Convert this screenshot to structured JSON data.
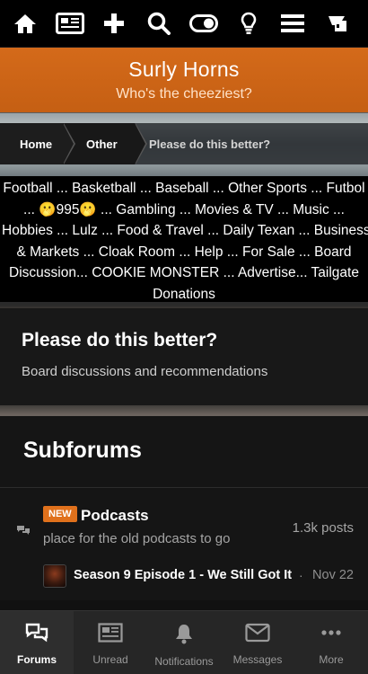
{
  "topbar": {
    "icons": [
      "home-icon",
      "news-icon",
      "plus-icon",
      "search-icon",
      "toggle-icon",
      "lightbulb-icon",
      "menu-icon",
      "flag-icon"
    ]
  },
  "site": {
    "title": "Surly Horns",
    "tagline": "Who's the cheeziest?"
  },
  "breadcrumb": {
    "items": [
      "Home",
      "Other",
      "Please do this better?"
    ]
  },
  "navlinks": {
    "rows": [
      "Football ... Basketball ... Baseball ... Other Sports ... Futbol",
      "... 🫢995🫢 ... Gambling ... Movies & TV ... Music ...",
      "Hobbies ... Lulz ... Food & Travel ... Daily Texan ... Business",
      "& Markets ... Cloak Room ... Help ... For Sale ... Board",
      "Discussion... COOKIE MONSTER ... Advertise... Tailgate",
      "Donations"
    ]
  },
  "forum": {
    "title": "Please do this better?",
    "description": "Board discussions and recommendations"
  },
  "subforums": {
    "heading": "Subforums",
    "items": [
      {
        "badge": "NEW",
        "name": "Podcasts",
        "description": "place for the old podcasts to go",
        "posts": "1.3k posts",
        "last_thread": "Season 9 Episode 1 - We Still Got It",
        "last_sep": "·",
        "last_date": "Nov 22"
      }
    ]
  },
  "bottomnav": {
    "items": [
      {
        "label": "Forums",
        "icon": "chat-bubbles-icon",
        "active": true
      },
      {
        "label": "Unread",
        "icon": "newspaper-icon",
        "active": false
      },
      {
        "label": "Notifications",
        "icon": "bell-icon",
        "active": false
      },
      {
        "label": "Messages",
        "icon": "envelope-icon",
        "active": false
      },
      {
        "label": "More",
        "icon": "more-dots-icon",
        "active": false
      }
    ]
  },
  "colors": {
    "accent": "#d46a1a",
    "topbar_bg": "#000000",
    "panel_bg": "#181818"
  }
}
